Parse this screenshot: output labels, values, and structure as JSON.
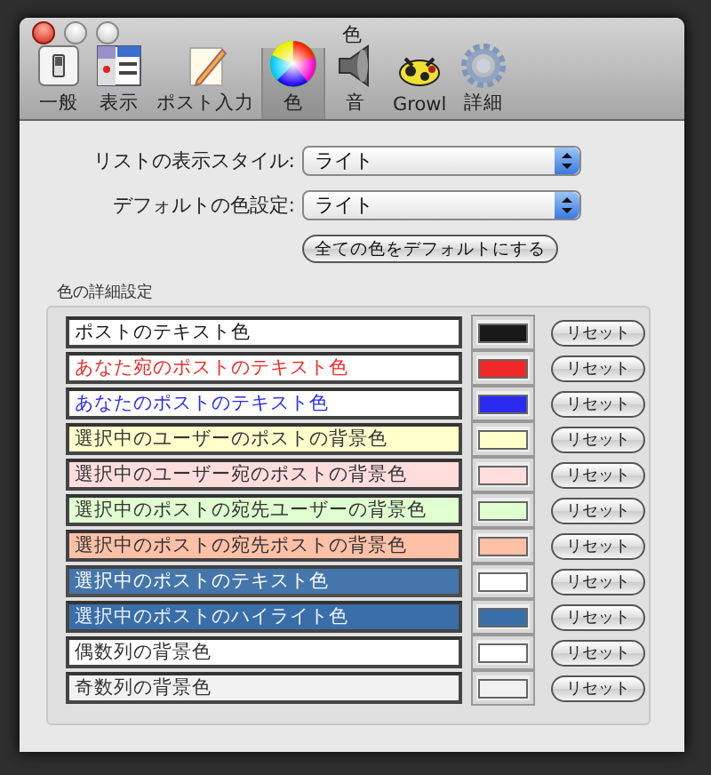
{
  "window": {
    "title": "色"
  },
  "toolbar": [
    {
      "label": "一般",
      "selected": false
    },
    {
      "label": "表示",
      "selected": false
    },
    {
      "label": "ポスト入力",
      "selected": false
    },
    {
      "label": "色",
      "selected": true
    },
    {
      "label": "音",
      "selected": false
    },
    {
      "label": "Growl",
      "selected": false
    },
    {
      "label": "詳細",
      "selected": false
    }
  ],
  "settings": [
    {
      "label": "リストの表示スタイル:",
      "value": "ライト"
    },
    {
      "label": "デフォルトの色設定:",
      "value": "ライト"
    }
  ],
  "reset_all_button": "全ての色をデフォルトにする",
  "group_title": "色の詳細設定",
  "color_rows": [
    {
      "label": "ポストのテキスト色",
      "kind": "text",
      "color": "#181818",
      "button": "リセット"
    },
    {
      "label": "あなた宛のポストのテキスト色",
      "kind": "text",
      "color": "#f02828",
      "button": "リセット"
    },
    {
      "label": "あなたのポストのテキスト色",
      "kind": "text",
      "color": "#2a2af0",
      "button": "リセット"
    },
    {
      "label": "選択中のユーザーのポストの背景色",
      "kind": "background",
      "color": "#ffffcc",
      "button": "リセット"
    },
    {
      "label": "選択中のユーザー宛のポストの背景色",
      "kind": "background",
      "color": "#ffdddd",
      "button": "リセット"
    },
    {
      "label": "選択中のポストの宛先ユーザーの背景色",
      "kind": "background",
      "color": "#e0ffd0",
      "button": "リセット"
    },
    {
      "label": "選択中のポストの宛先ポストの背景色",
      "kind": "background",
      "color": "#ffc0a8",
      "button": "リセット"
    },
    {
      "label": "選択中のポストのテキスト色",
      "kind": "selected_text",
      "color": "#ffffff",
      "button": "リセット"
    },
    {
      "label": "選択中のポストのハイライト色",
      "kind": "highlight",
      "color": "#3a6ea8",
      "button": "リセット"
    },
    {
      "label": "偶数列の背景色",
      "kind": "background",
      "color": "#ffffff",
      "button": "リセット"
    },
    {
      "label": "奇数列の背景色",
      "kind": "background",
      "color": "#f2f2f2",
      "button": "リセット"
    }
  ]
}
